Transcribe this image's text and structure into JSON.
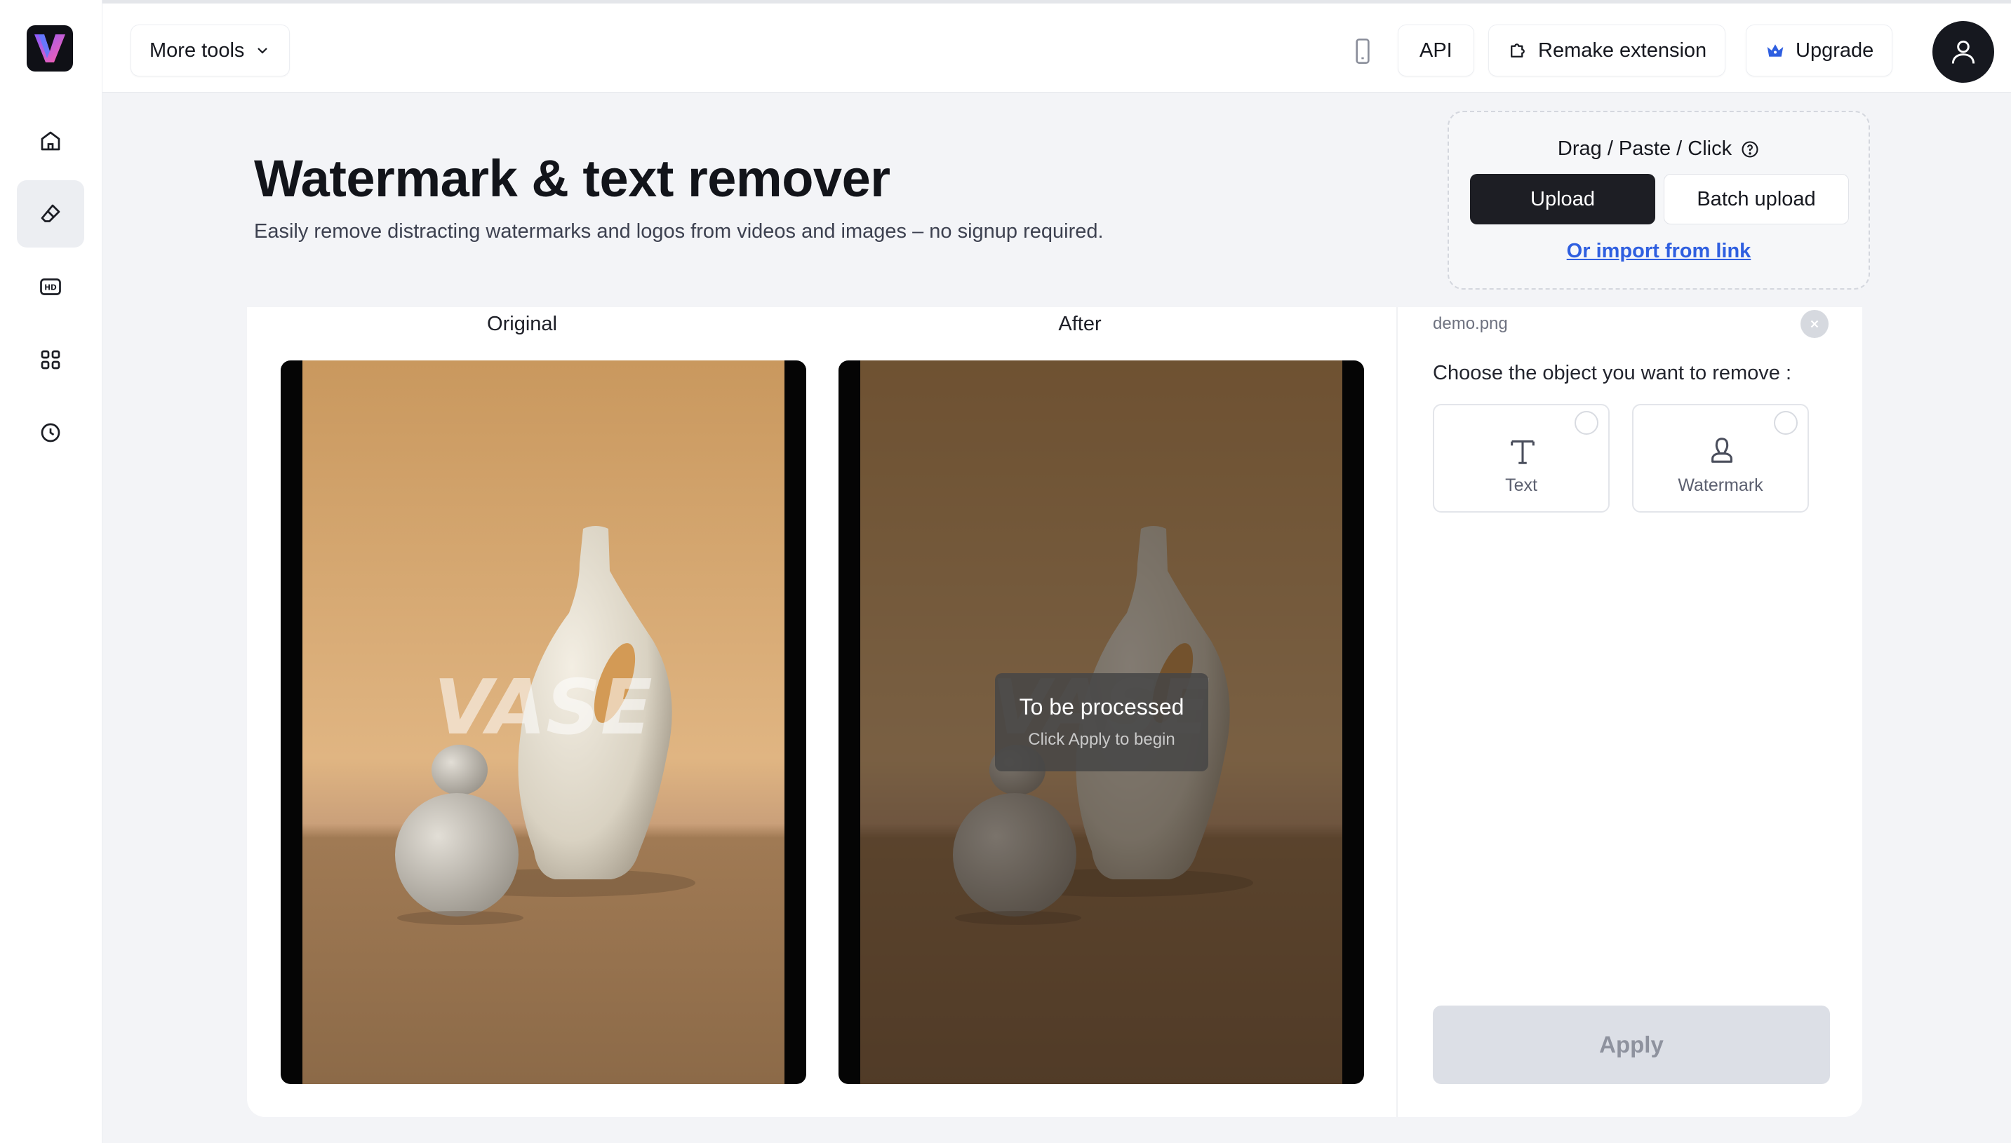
{
  "app": {
    "logo_letter": "V",
    "brand_gradient": [
      "#7d4bff",
      "#ff5fa8"
    ]
  },
  "sidebar": {
    "items": [
      {
        "icon": "home-icon",
        "active": false
      },
      {
        "icon": "eraser-icon",
        "active": true
      },
      {
        "icon": "hd-icon",
        "active": false
      },
      {
        "icon": "grid-icon",
        "active": false
      },
      {
        "icon": "clock-icon",
        "active": false
      }
    ]
  },
  "topbar": {
    "more_tools": "More tools",
    "api": "API",
    "remake_extension": "Remake extension",
    "upgrade": "Upgrade",
    "upgrade_icon_color": "#2f5fe0"
  },
  "header": {
    "title": "Watermark & text remover",
    "subtitle": "Easily remove distracting watermarks and logos from videos and images – no signup required."
  },
  "upload": {
    "drag_label": "Drag / Paste / Click",
    "upload_button": "Upload",
    "batch_button": "Batch upload",
    "import_link": "Or import from link"
  },
  "preview": {
    "original_label": "Original",
    "after_label": "After",
    "watermark_text": "VASE",
    "overlay_title": "To be processed",
    "overlay_hint": "Click Apply to begin"
  },
  "panel": {
    "filename": "demo.png",
    "choose_prompt": "Choose the object you want to remove :",
    "options": [
      {
        "label": "Text",
        "icon": "text-icon",
        "selected": false
      },
      {
        "label": "Watermark",
        "icon": "watermark-icon",
        "selected": false
      }
    ],
    "apply_button": "Apply"
  }
}
